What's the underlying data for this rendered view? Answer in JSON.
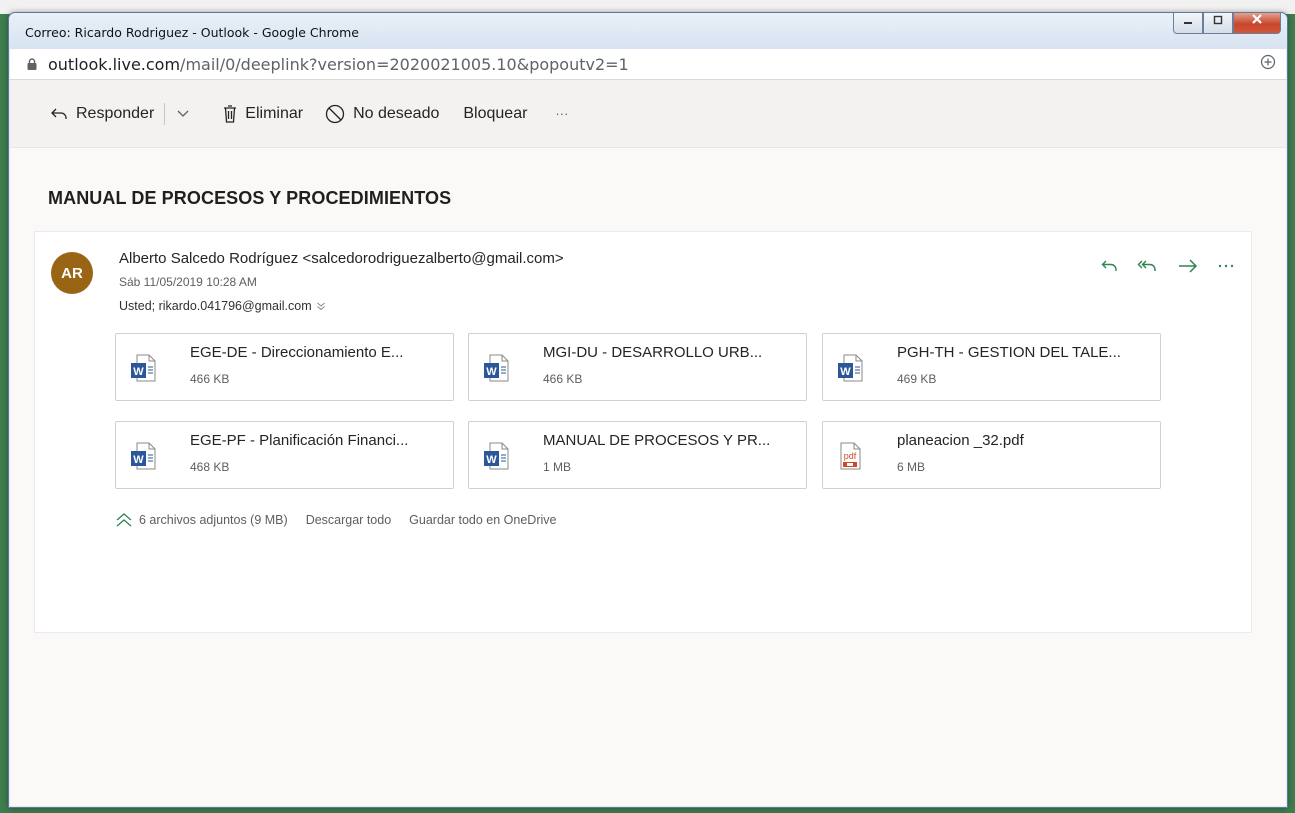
{
  "window": {
    "title": "Correo: Ricardo Rodriguez - Outlook - Google Chrome",
    "url_host": "outlook.live.com",
    "url_path": "/mail/0/deeplink?version=2020021005.10&popoutv2=1"
  },
  "toolbar": {
    "reply": "Responder",
    "delete": "Eliminar",
    "junk": "No deseado",
    "block": "Bloquear",
    "more": "···"
  },
  "message": {
    "subject": "MANUAL DE PROCESOS Y PROCEDIMIENTOS",
    "avatar_initials": "AR",
    "avatar_color": "#996515",
    "from": "Alberto Salcedo Rodríguez <salcedorodriguezalberto@gmail.com>",
    "date": "Sáb 11/05/2019 10:28 AM",
    "to": "Usted; rikardo.041796@gmail.com"
  },
  "attachments": [
    {
      "name": "EGE-DE - Direccionamiento E...",
      "size": "466 KB",
      "type": "word-icon"
    },
    {
      "name": "MGI-DU - DESARROLLO URB...",
      "size": "466 KB",
      "type": "word-icon"
    },
    {
      "name": "PGH-TH - GESTION DEL TALE...",
      "size": "469 KB",
      "type": "word-icon"
    },
    {
      "name": "EGE-PF - Planificación Financi...",
      "size": "468 KB",
      "type": "word-icon"
    },
    {
      "name": "MANUAL DE PROCESOS Y PR...",
      "size": "1 MB",
      "type": "word-icon"
    },
    {
      "name": "planeacion _32.pdf",
      "size": "6 MB",
      "type": "pdf-icon"
    }
  ],
  "attachments_footer": {
    "count": "6 archivos adjuntos (9 MB)",
    "download_all": "Descargar todo",
    "save_onedrive": "Guardar todo en OneDrive"
  },
  "colors": {
    "accent_green": "#2f8450",
    "word_blue": "#2b579a",
    "pdf_red": "#d24726"
  }
}
